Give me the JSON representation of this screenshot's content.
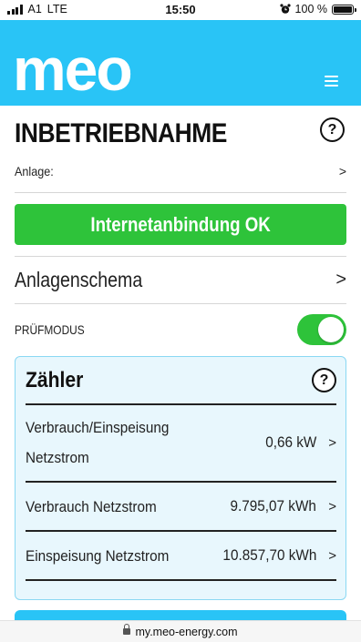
{
  "status_bar": {
    "carrier": "A1",
    "network": "LTE",
    "time": "15:50",
    "battery_text": "100 %",
    "battery_level": 1.0
  },
  "header": {
    "logo_text": "meo",
    "menu_icon": "hamburger-menu-icon",
    "background_color": "#29c4f6"
  },
  "page": {
    "title": "INBETRIEBNAHME",
    "help_icon_text": "?",
    "anlage_label": "Anlage:",
    "anlage_chevron": ">",
    "internet_status": "Internetanbindung OK",
    "internet_status_color": "#2ec33a",
    "anlagenschema_label": "Anlagenschema",
    "anlagenschema_chevron": ">",
    "pruefmodus_label": "PRÜFMODUS",
    "pruefmodus_enabled": true
  },
  "zaehler": {
    "title": "Zähler",
    "help_icon_text": "?",
    "rows": [
      {
        "label_line1": "Verbrauch/Einspeisung",
        "label_line2": "Netzstrom",
        "value": "0,66 kW",
        "chevron": ">"
      },
      {
        "label": "Verbrauch Netzstrom",
        "value": "9.795,07 kWh",
        "chevron": ">"
      },
      {
        "label": "Einspeisung Netzstrom",
        "value": "10.857,70 kWh",
        "chevron": ">"
      }
    ]
  },
  "url_bar": {
    "url": "my.meo-energy.com"
  }
}
